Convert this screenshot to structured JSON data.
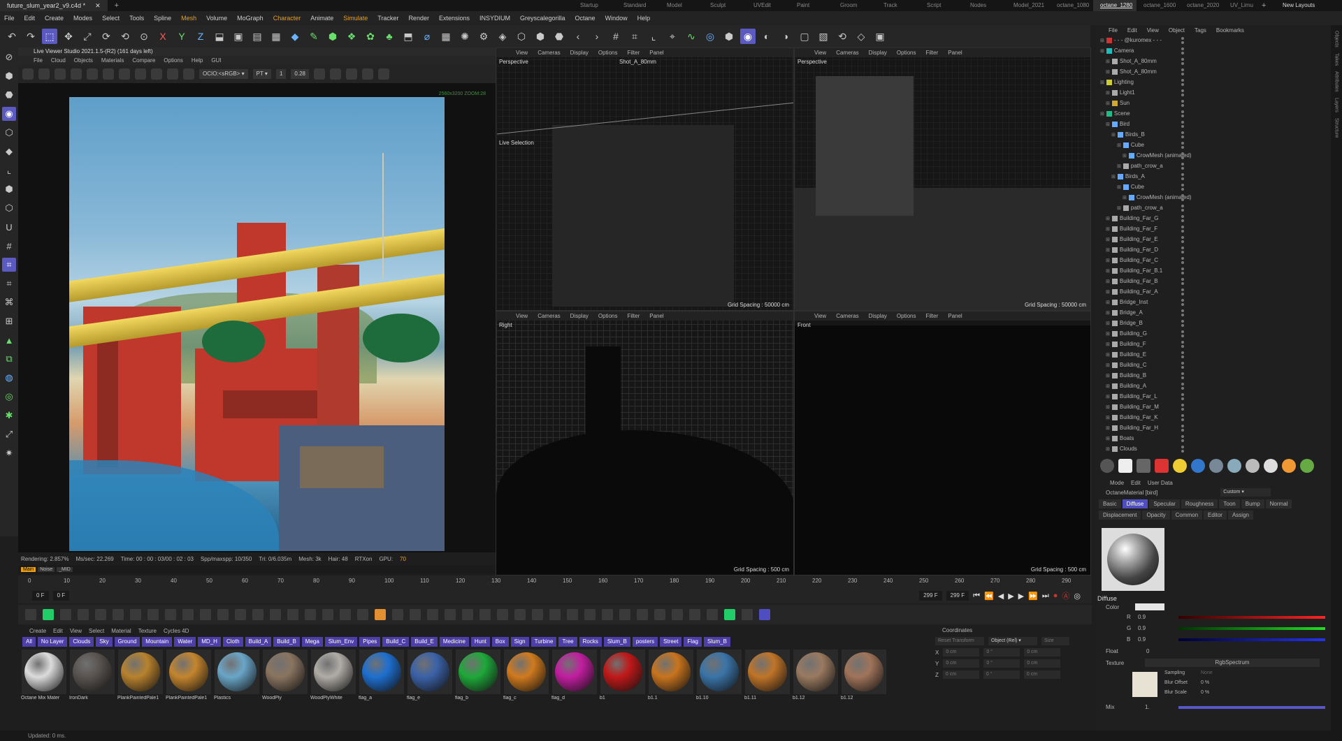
{
  "title_tab": "future_slum_year2_v9.c4d *",
  "layouts": [
    "Startup",
    "Standard",
    "Model",
    "Sculpt",
    "UVEdit",
    "Paint",
    "Groom",
    "Track",
    "Script",
    "Nodes",
    "Model_2021",
    "octane_1080",
    "octane_1280",
    "octane_1600",
    "octane_2020",
    "UV_Limu"
  ],
  "active_layout": "octane_1280",
  "new_layouts": "New Layouts",
  "menu": [
    "File",
    "Edit",
    "Create",
    "Modes",
    "Select",
    "Tools",
    "Spline",
    "Mesh",
    "Volume",
    "MoGraph",
    "Character",
    "Animate",
    "Simulate",
    "Tracker",
    "Render",
    "Extensions",
    "INSYDIUM",
    "Greyscalegorilla",
    "Octane",
    "Window",
    "Help"
  ],
  "live_viewer": {
    "title": "Live Viewer Studio 2021.1.5-(R2) (161 days left)",
    "menu": [
      "File",
      "Cloud",
      "Objects",
      "Materials",
      "Compare",
      "Options",
      "Help",
      "GUI"
    ],
    "ocio": "OCIO:<sRGB>",
    "pt": "PT",
    "val1": "1",
    "val2": "0.28",
    "corner": "2560x3200 ZOOM:28",
    "stats": {
      "rendering": "Rendering: 2.857%",
      "ms": "Ms/sec: 22.269",
      "time": "Time: 00 : 00 : 03/00 : 02 : 03",
      "spp": "Spp/maxspp: 10/350",
      "tri": "Tri: 0/6.035m",
      "mesh": "Mesh: 3k",
      "hair": "Hair: 48",
      "rtx": "RTXon",
      "gpu": "GPU:",
      "gpu_val": "70"
    },
    "tabs": [
      "Main",
      "Noise",
      "_MID"
    ]
  },
  "viewports": [
    {
      "menu": [
        "View",
        "Cameras",
        "Display",
        "Options",
        "Filter",
        "Panel"
      ],
      "name": "Perspective",
      "camera": "Shot_A_80mm",
      "grid": "Grid Spacing : 50000 cm",
      "live": "Live Selection"
    },
    {
      "menu": [
        "View",
        "Cameras",
        "Display",
        "Options",
        "Filter",
        "Panel"
      ],
      "name": "Perspective",
      "grid": "Grid Spacing : 50000 cm"
    },
    {
      "menu": [
        "View",
        "Cameras",
        "Display",
        "Options",
        "Filter",
        "Panel"
      ],
      "name": "Right",
      "grid": "Grid Spacing : 500 cm"
    },
    {
      "menu": [
        "View",
        "Cameras",
        "Display",
        "Options",
        "Filter",
        "Panel"
      ],
      "name": "Front",
      "grid": "Grid Spacing : 500 cm"
    }
  ],
  "timeline": {
    "ticks": [
      "0",
      "10",
      "20",
      "30",
      "40",
      "50",
      "60",
      "70",
      "80",
      "90",
      "100",
      "110",
      "120",
      "130",
      "140",
      "150",
      "160",
      "170",
      "180",
      "190",
      "200",
      "210",
      "220",
      "230",
      "240",
      "250",
      "260",
      "270",
      "280",
      "290"
    ],
    "start": "0 F",
    "start2": "0 F",
    "end": "299 F",
    "end2": "299 F"
  },
  "material_manager": {
    "menu": [
      "Create",
      "Edit",
      "View",
      "Select",
      "Material",
      "Texture",
      "Cycles 4D"
    ],
    "tags": [
      "All",
      "No Layer",
      "Clouds",
      "Sky",
      "Ground",
      "Mountain",
      "Water",
      "MD_H",
      "Cloth",
      "Build_A",
      "Build_B",
      "Mega",
      "Slum_Env",
      "Pipes",
      "Build_C",
      "Build_E",
      "Medicine",
      "Hunt",
      "Box",
      "Sign",
      "Turbine",
      "Tree",
      "Rocks",
      "Slum_B",
      "posters",
      "Street",
      "Flag",
      "Slum_B"
    ],
    "materials": [
      {
        "name": "Octane Mix Mater",
        "color": "#dcdcdc"
      },
      {
        "name": "IronDark",
        "color": "#5a5450"
      },
      {
        "name": "PlankPaintedPale1",
        "color": "#b8822e"
      },
      {
        "name": "PlankPaintedPale1",
        "color": "#c4852e"
      },
      {
        "name": "Plastics",
        "color": "#6aa6c8"
      },
      {
        "name": "WoodPly",
        "color": "#8a7460"
      },
      {
        "name": "WoodPlyWhite",
        "color": "#b0aca6"
      },
      {
        "name": "flag_a",
        "color": "#1e6fd0"
      },
      {
        "name": "flag_e",
        "color": "#3b62a8"
      },
      {
        "name": "flag_b",
        "color": "#1fa83a"
      },
      {
        "name": "flag_c",
        "color": "#d07a1e"
      },
      {
        "name": "flag_d",
        "color": "#c21ea0"
      },
      {
        "name": "b1",
        "color": "#c01818"
      },
      {
        "name": "b1.1",
        "color": "#c8741e"
      },
      {
        "name": "b1.10",
        "color": "#3a74a8"
      },
      {
        "name": "b1.11",
        "color": "#c07428"
      },
      {
        "name": "b1.12",
        "color": "#9a7a60"
      },
      {
        "name": "b1.12",
        "color": "#a0745a"
      }
    ]
  },
  "coordinates": {
    "title": "Coordinates",
    "reset": "Reset Transform",
    "mode": "Object (Rel)",
    "size": "Size",
    "rows": [
      {
        "axis": "X",
        "pos": "0 cm",
        "rot": "0 °",
        "size": "0 cm"
      },
      {
        "axis": "Y",
        "pos": "0 cm",
        "rot": "0 °",
        "size": "0 cm"
      },
      {
        "axis": "Z",
        "pos": "0 cm",
        "rot": "0 °",
        "size": "0 cm"
      }
    ]
  },
  "status": "Updated: 0 ms.",
  "object_manager": {
    "menu": [
      "File",
      "Edit",
      "View",
      "Object",
      "Tags",
      "Bookmarks"
    ],
    "items": [
      {
        "name": "- - - @kuromex - - -",
        "indent": 0,
        "color": "#c33"
      },
      {
        "name": "Camera",
        "indent": 0,
        "color": "#2bb"
      },
      {
        "name": "Shot_A_80mm",
        "indent": 1,
        "color": "#aaa"
      },
      {
        "name": "Shot_A_80mm",
        "indent": 1,
        "color": "#aaa"
      },
      {
        "name": "Lighting",
        "indent": 0,
        "color": "#cc3"
      },
      {
        "name": "Light1",
        "indent": 1,
        "color": "#aaa"
      },
      {
        "name": "Sun",
        "indent": 1,
        "color": "#ca3"
      },
      {
        "name": "Scene",
        "indent": 0,
        "color": "#2b8"
      },
      {
        "name": "Bird",
        "indent": 1,
        "color": "#6af"
      },
      {
        "name": "Birds_B",
        "indent": 2,
        "color": "#6af"
      },
      {
        "name": "Cube",
        "indent": 3,
        "color": "#6af"
      },
      {
        "name": "CrowMesh (animated)",
        "indent": 4,
        "color": "#6af"
      },
      {
        "name": "path_crow_a",
        "indent": 3,
        "color": "#aaa"
      },
      {
        "name": "Birds_A",
        "indent": 2,
        "color": "#6af"
      },
      {
        "name": "Cube",
        "indent": 3,
        "color": "#6af"
      },
      {
        "name": "CrowMesh (animated)",
        "indent": 4,
        "color": "#6af"
      },
      {
        "name": "path_crow_a",
        "indent": 3,
        "color": "#aaa"
      },
      {
        "name": "Building_Far_G",
        "indent": 1,
        "color": "#aaa"
      },
      {
        "name": "Building_Far_F",
        "indent": 1,
        "color": "#aaa"
      },
      {
        "name": "Building_Far_E",
        "indent": 1,
        "color": "#aaa"
      },
      {
        "name": "Building_Far_D",
        "indent": 1,
        "color": "#aaa"
      },
      {
        "name": "Building_Far_C",
        "indent": 1,
        "color": "#aaa"
      },
      {
        "name": "Building_Far_B.1",
        "indent": 1,
        "color": "#aaa"
      },
      {
        "name": "Building_Far_B",
        "indent": 1,
        "color": "#aaa"
      },
      {
        "name": "Building_Far_A",
        "indent": 1,
        "color": "#aaa"
      },
      {
        "name": "Bridge_Inst",
        "indent": 1,
        "color": "#aaa"
      },
      {
        "name": "Bridge_A",
        "indent": 1,
        "color": "#aaa"
      },
      {
        "name": "Bridge_B",
        "indent": 1,
        "color": "#aaa"
      },
      {
        "name": "Building_G",
        "indent": 1,
        "color": "#aaa"
      },
      {
        "name": "Building_F",
        "indent": 1,
        "color": "#aaa"
      },
      {
        "name": "Building_E",
        "indent": 1,
        "color": "#aaa"
      },
      {
        "name": "Building_C",
        "indent": 1,
        "color": "#aaa"
      },
      {
        "name": "Building_B",
        "indent": 1,
        "color": "#aaa"
      },
      {
        "name": "Building_A",
        "indent": 1,
        "color": "#aaa"
      },
      {
        "name": "Building_Far_L",
        "indent": 1,
        "color": "#aaa"
      },
      {
        "name": "Building_Far_M",
        "indent": 1,
        "color": "#aaa"
      },
      {
        "name": "Building_Far_K",
        "indent": 1,
        "color": "#aaa"
      },
      {
        "name": "Building_Far_H",
        "indent": 1,
        "color": "#aaa"
      },
      {
        "name": "Boats",
        "indent": 1,
        "color": "#aaa"
      },
      {
        "name": "Clouds",
        "indent": 1,
        "color": "#aaa"
      }
    ]
  },
  "attributes": {
    "menu": [
      "Mode",
      "Edit",
      "User Data"
    ],
    "name": "OctaneMaterial [bird]",
    "preset": "Custom",
    "tabs1": [
      "Basic",
      "Diffuse",
      "Specular",
      "Roughness",
      "Toon",
      "Bump",
      "Normal"
    ],
    "tabs2": [
      "Displacement",
      "Opacity",
      "Common",
      "Editor",
      "Assign"
    ],
    "active_tab": "Diffuse",
    "section": "Diffuse",
    "color_label": "Color",
    "r_label": "R",
    "r": "0.9",
    "g_label": "G",
    "g": "0.9",
    "b_label": "B",
    "b": "0.9",
    "float_label": "Float",
    "float": "0",
    "texture_label": "Texture",
    "texture": "RgbSpectrum",
    "sampling_label": "Sampling",
    "sampling": "None",
    "blur_offset_label": "Blur Offset",
    "blur_offset": "0 %",
    "blur_scale_label": "Blur Scale",
    "blur_scale": "0 %",
    "mix_label": "Mix",
    "mix": "1."
  },
  "right_sidebar": [
    "Objects",
    "Takes",
    "Attributes",
    "Layers",
    "Structure"
  ]
}
